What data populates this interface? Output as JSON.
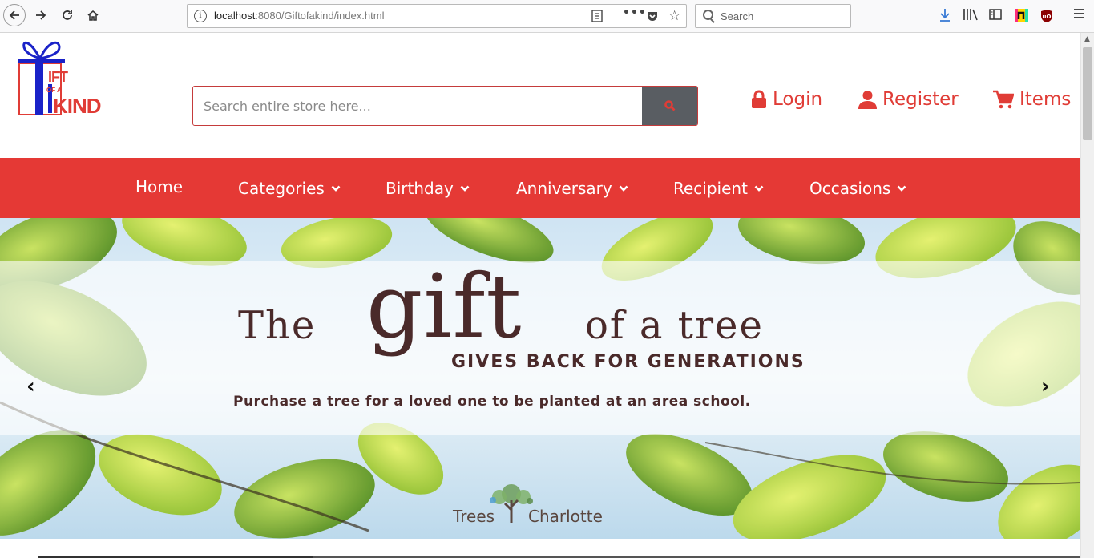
{
  "browser": {
    "url_host": "localhost",
    "url_rest": ":8080/Giftofakind/index.html",
    "search_placeholder": "Search"
  },
  "header": {
    "logo_letters_top": "IFT",
    "logo_letters_mid": "OF A",
    "logo_letters_bottom": "KIND",
    "search_placeholder": "Search entire store here...",
    "login_label": "Login",
    "register_label": "Register",
    "items_label": "Items"
  },
  "nav": {
    "home": "Home",
    "categories": "Categories",
    "birthday": "Birthday",
    "anniversary": "Anniversary",
    "recipient": "Recipient",
    "occasions": "Occasions"
  },
  "banner": {
    "the": "The",
    "gift": "gift",
    "of_a_tree": "of a tree",
    "tagline": "GIVES BACK FOR GENERATIONS",
    "purchase": "Purchase a tree for a loved one to be planted at an area school.",
    "brand_left": "Trees",
    "brand_right": "Charlotte",
    "prev": "‹",
    "next": "›"
  },
  "colors": {
    "brand_red": "#e53935",
    "link_red": "#e03c36",
    "logo_blue": "#1a22c8",
    "search_button": "#595d62",
    "banner_text": "#4a2a2a"
  }
}
